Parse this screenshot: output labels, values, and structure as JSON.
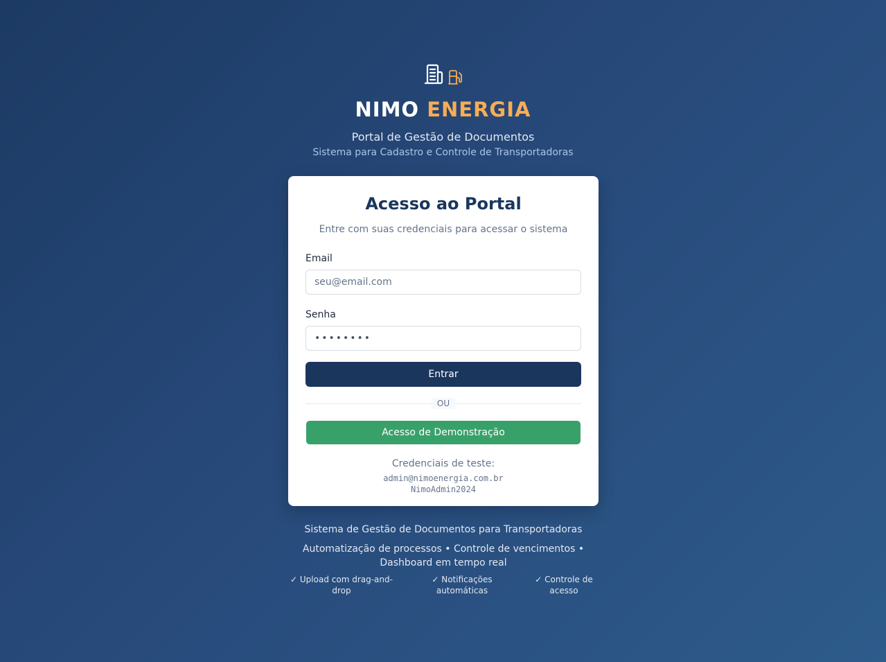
{
  "brand": {
    "title_main": "NIMO",
    "title_accent": "ENERGIA",
    "subtitle": "Portal de Gestão de Documentos",
    "tagline": "Sistema para Cadastro e Controle de Transportadoras",
    "icons": [
      "building-icon",
      "fuel-pump-icon"
    ],
    "accent_color": "#f6ad55"
  },
  "login": {
    "title": "Acesso ao Portal",
    "subtitle": "Entre com suas credenciais para acessar o sistema",
    "email_label": "Email",
    "email_value": "",
    "email_placeholder": "seu@email.com",
    "password_label": "Senha",
    "password_value": "••••••••",
    "password_placeholder": "••••••••",
    "submit_label": "Entrar",
    "divider_label": "OU",
    "demo_label": "Acesso de Demonstração",
    "credentials_label": "Credenciais de teste:",
    "credentials_email": "admin@nimoenergia.com.br",
    "credentials_password": "NimoAdmin2024",
    "primary_color": "#1a365d",
    "demo_color": "#38a169"
  },
  "footer": {
    "line1": "Sistema de Gestão de Documentos para Transportadoras",
    "line2": "Automatização de processos • Controle de vencimentos • Dashboard em tempo real",
    "features": [
      "✓ Upload com drag-and-drop",
      "✓ Notificações automáticas",
      "✓ Controle de acesso"
    ]
  }
}
